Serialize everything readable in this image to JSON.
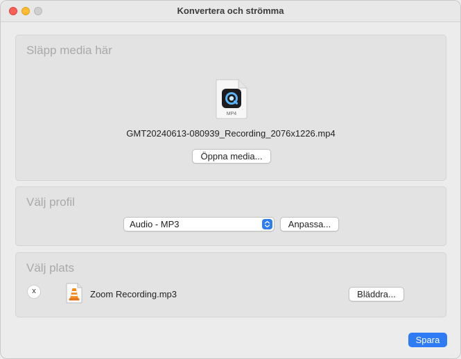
{
  "window": {
    "title": "Konvertera och strömma"
  },
  "source": {
    "section_title": "Släpp media här",
    "file_type_label": "MP4",
    "filename": "GMT20240613-080939_Recording_2076x1226.mp4",
    "open_button": "Öppna media...",
    "icon": "quicktime-file-icon"
  },
  "profile": {
    "section_title": "Välj profil",
    "selected": "Audio - MP3",
    "customize_button": "Anpassa..."
  },
  "destination": {
    "section_title": "Välj plats",
    "remove_label": "x",
    "filename": "Zoom Recording.mp3",
    "browse_button": "Bläddra...",
    "icon": "vlc-file-icon"
  },
  "footer": {
    "save_button": "Spara"
  },
  "colors": {
    "accent": "#2f7bf6",
    "close": "#fe5f57",
    "minimize": "#febc2e"
  }
}
